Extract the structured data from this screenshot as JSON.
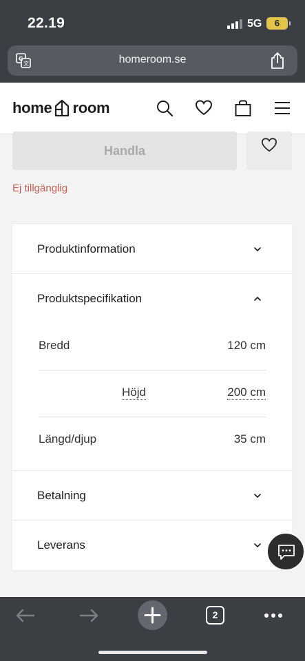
{
  "status_bar": {
    "time": "22.19",
    "network": "5G",
    "battery": "6"
  },
  "browser": {
    "url": "homeroom.se",
    "tab_count": "2"
  },
  "header": {
    "logo_left": "home",
    "logo_right": "room"
  },
  "product": {
    "buy_label": "Handla",
    "availability": "Ej tillgänglig"
  },
  "accordion": {
    "info_title": "Produktinformation",
    "spec_title": "Produktspecifikation",
    "specs": [
      {
        "label": "Bredd",
        "value": "120 cm"
      },
      {
        "label": "Höjd",
        "value": "200 cm"
      },
      {
        "label": "Längd/djup",
        "value": "35 cm"
      }
    ],
    "payment_title": "Betalning",
    "delivery_title": "Leverans"
  },
  "colors": {
    "browser_chrome": "#3b3f44",
    "unavailable_text": "#c95b4f",
    "battery": "#e3c44a"
  }
}
